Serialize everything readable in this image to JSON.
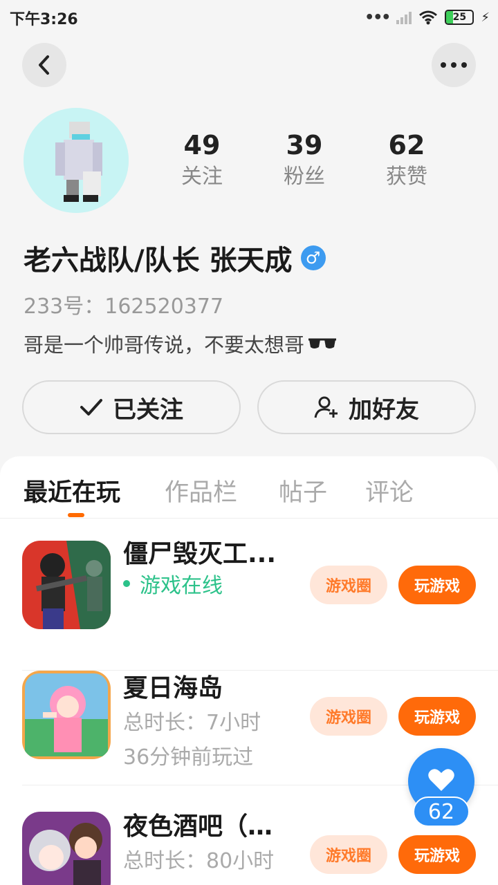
{
  "status_bar": {
    "time": "下午3:26",
    "battery": "25",
    "battery_level": 0.25
  },
  "profile": {
    "stats": [
      {
        "value": "49",
        "label": "关注"
      },
      {
        "value": "39",
        "label": "粉丝"
      },
      {
        "value": "62",
        "label": "获赞"
      }
    ],
    "username": "老六战队/队长 张天成",
    "gender_symbol": "♂",
    "uid": "233号：162520377",
    "bio": "哥是一个帅哥传说，不要太想哥"
  },
  "actions": {
    "follow_label": "已关注",
    "add_friend_label": "加好友"
  },
  "tabs": [
    {
      "label": "最近在玩"
    },
    {
      "label": "作品栏"
    },
    {
      "label": "帖子"
    },
    {
      "label": "评论"
    }
  ],
  "games": [
    {
      "name": "僵尸毁灭工...",
      "line1": "游戏在线",
      "line2": "",
      "circle_label": "游戏圈",
      "play_label": "玩游戏"
    },
    {
      "name": "夏日海岛",
      "line1": "总时长：7小时",
      "line2": "36分钟前玩过",
      "circle_label": "游戏圈",
      "play_label": "玩游戏"
    },
    {
      "name": "夜色酒吧（测...",
      "line1": "总时长：80小时",
      "line2": "",
      "circle_label": "游戏圈",
      "play_label": "玩游戏"
    }
  ],
  "like_count": "62"
}
